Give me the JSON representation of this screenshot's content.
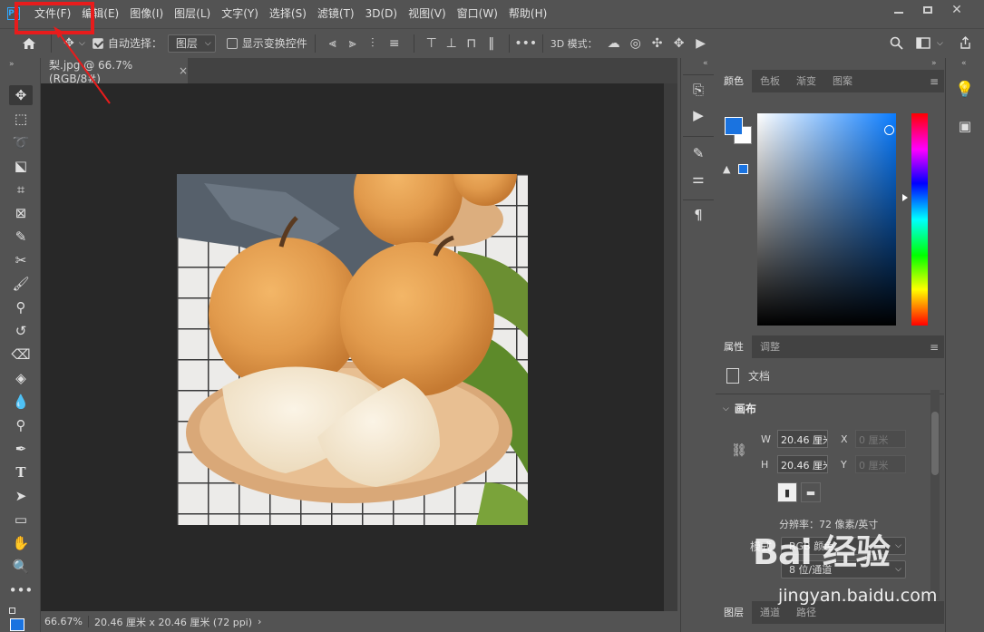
{
  "menubar": {
    "logo_text": "Ps",
    "items": [
      "文件(F)",
      "编辑(E)",
      "图像(I)",
      "图层(L)",
      "文字(Y)",
      "选择(S)",
      "滤镜(T)",
      "3D(D)",
      "视图(V)",
      "窗口(W)",
      "帮助(H)"
    ]
  },
  "options": {
    "auto_select_label": "自动选择：",
    "auto_select_checked": true,
    "layer_select_value": "图层",
    "show_transform_label": "显示变换控件",
    "show_transform_checked": false,
    "three_d_mode_label": "3D 模式："
  },
  "document": {
    "tab_title": "梨.jpg @ 66.7%(RGB/8#)"
  },
  "status": {
    "zoom": "66.67%",
    "info": "20.46 厘米 x 20.46 厘米 (72 ppi)"
  },
  "color_panel": {
    "tabs": [
      "颜色",
      "色板",
      "渐变",
      "图案"
    ],
    "foreground": "#1a73e0",
    "background": "#ffffff"
  },
  "properties_panel": {
    "tabs": [
      "属性",
      "调整"
    ],
    "doc_label": "文档",
    "section_title": "画布",
    "w_label": "W",
    "w_value": "20.46 厘米",
    "h_label": "H",
    "h_value": "20.46 厘米",
    "x_label": "X",
    "x_placeholder": "0 厘米",
    "y_label": "Y",
    "y_placeholder": "0 厘米",
    "resolution_text": "分辨率：72 像素/英寸",
    "mode_label": "模式",
    "mode_value": "RGB 颜色",
    "bit_depth_value": "8 位/通道"
  },
  "layers_panel": {
    "tabs": [
      "图层",
      "通道",
      "路径"
    ]
  },
  "watermark": {
    "logo": "Bai 经验",
    "url": "jingyan.baidu.com"
  },
  "icons": {
    "home": "home-icon",
    "move": "move-icon",
    "search": "search-icon",
    "share": "share-icon",
    "learn": "lightbulb-icon"
  }
}
